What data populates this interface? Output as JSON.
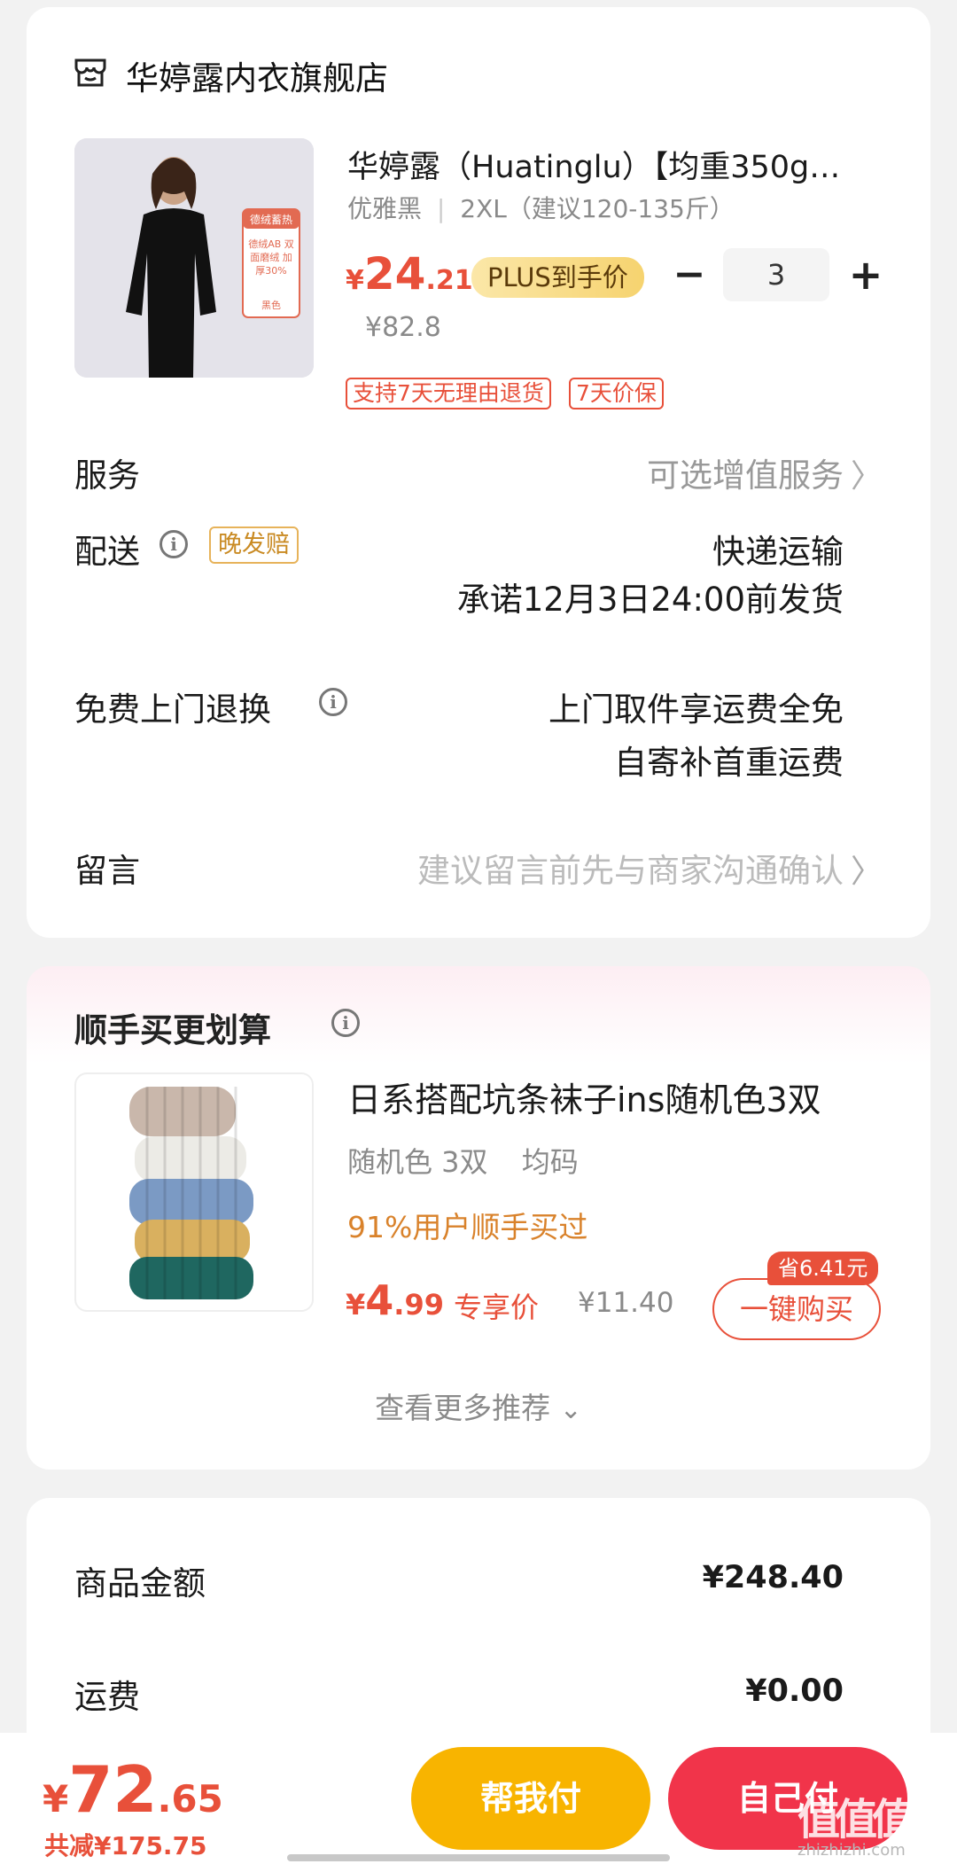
{
  "store": {
    "name": "华婷露内衣旗舰店",
    "icon": "store-icon"
  },
  "product": {
    "title": "华婷露（Huatinglu）【均重350g…",
    "spec_color": "优雅黑",
    "spec_size": "2XL（建议120-135斤）",
    "price_symbol": "¥",
    "price_int": "24",
    "price_dec": ".21",
    "plus_label": "PLUS到手价",
    "original_price": "¥82.8",
    "quantity": "3",
    "minus_label": "−",
    "plus_btn_label": "+",
    "tags": [
      "支持7天无理由退货",
      "7天价保"
    ],
    "image_badge_top": "德绒蓄热",
    "image_badge_body": "德绒AB 双面磨绒 加厚30%",
    "image_badge_color": "黑色"
  },
  "rows": {
    "service_label": "服务",
    "service_value": "可选增值服务",
    "delivery_label": "配送",
    "delivery_badge": "晚发赔",
    "delivery_line1": "快递运输",
    "delivery_line2": "承诺12月3日24:00前发货",
    "return_label": "免费上门退换",
    "return_line1": "上门取件享运费全免",
    "return_line2": "自寄补首重运费",
    "message_label": "留言",
    "message_placeholder": "建议留言前先与商家沟通确认",
    "chevron": "〉"
  },
  "upsell": {
    "header": "顺手买更划算",
    "item_title": "日系搭配坑条袜子ins随机色3双",
    "item_spec1": "随机色 3双",
    "item_spec2": "均码",
    "buyers_note": "91%用户顺手买过",
    "price_symbol": "¥",
    "price_int": "4",
    "price_dec": ".99",
    "exclusive_label": "专享价",
    "original_price": "¥11.40",
    "save_badge": "省6.41元",
    "onekey_label": "一键购买",
    "more_label": "查看更多推荐",
    "more_chevron": "⌄"
  },
  "summary": {
    "goods_label": "商品金额",
    "goods_value": "¥248.40",
    "shipping_label": "运费",
    "shipping_value": "¥0.00"
  },
  "bottom": {
    "total_symbol": "¥",
    "total_int": "72",
    "total_dec": ".65",
    "discount_text": "共减¥175.75",
    "help_pay_label": "帮我付",
    "self_pay_label": "自己付",
    "watermark_logo": "值值值",
    "watermark_text": "zhizhizhi.com"
  },
  "colors": {
    "accent_red": "#e8503a",
    "help_pay_yellow": "#f8b400",
    "self_pay_red": "#f1344a",
    "buyers_orange": "#d9822b"
  }
}
